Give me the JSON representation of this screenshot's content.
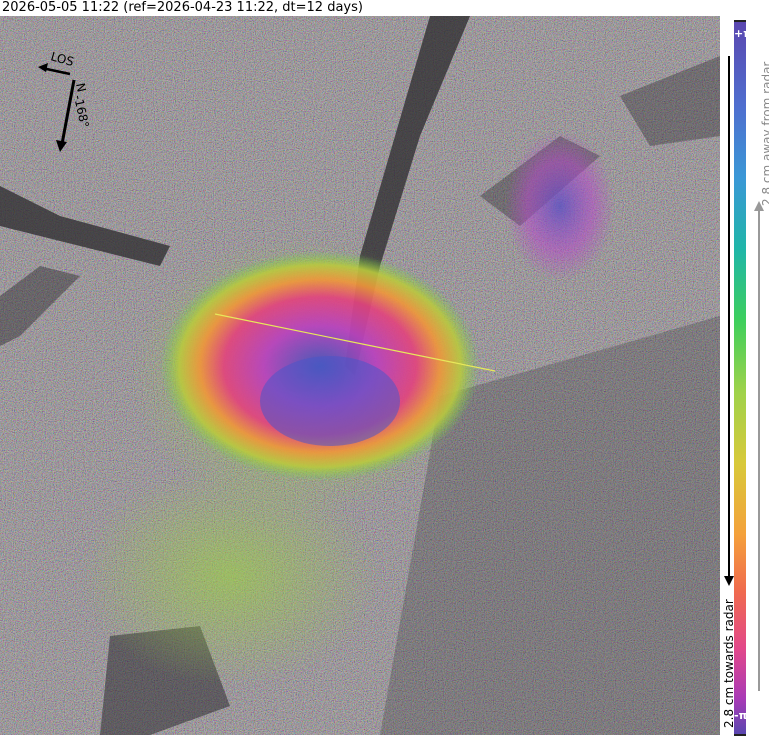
{
  "header": {
    "title": "2026-05-05 11:22 (ref=2026-04-23 11:22, dt=12 days)"
  },
  "compass": {
    "los_label": "LOS",
    "north_label": "N",
    "heading_label": "-168°"
  },
  "colorbar": {
    "top_label": "+π",
    "bottom_label": "-π",
    "away_label": "2.8 cm away from radar",
    "towards_label": "2.8 cm towards radar"
  },
  "colors": {
    "fringe_magenta": "#c23bc6",
    "fringe_blue": "#4a55c8",
    "fringe_orange": "#e98a3c",
    "fringe_green": "#6ccf4d",
    "profile_line": "#e8e85a"
  }
}
